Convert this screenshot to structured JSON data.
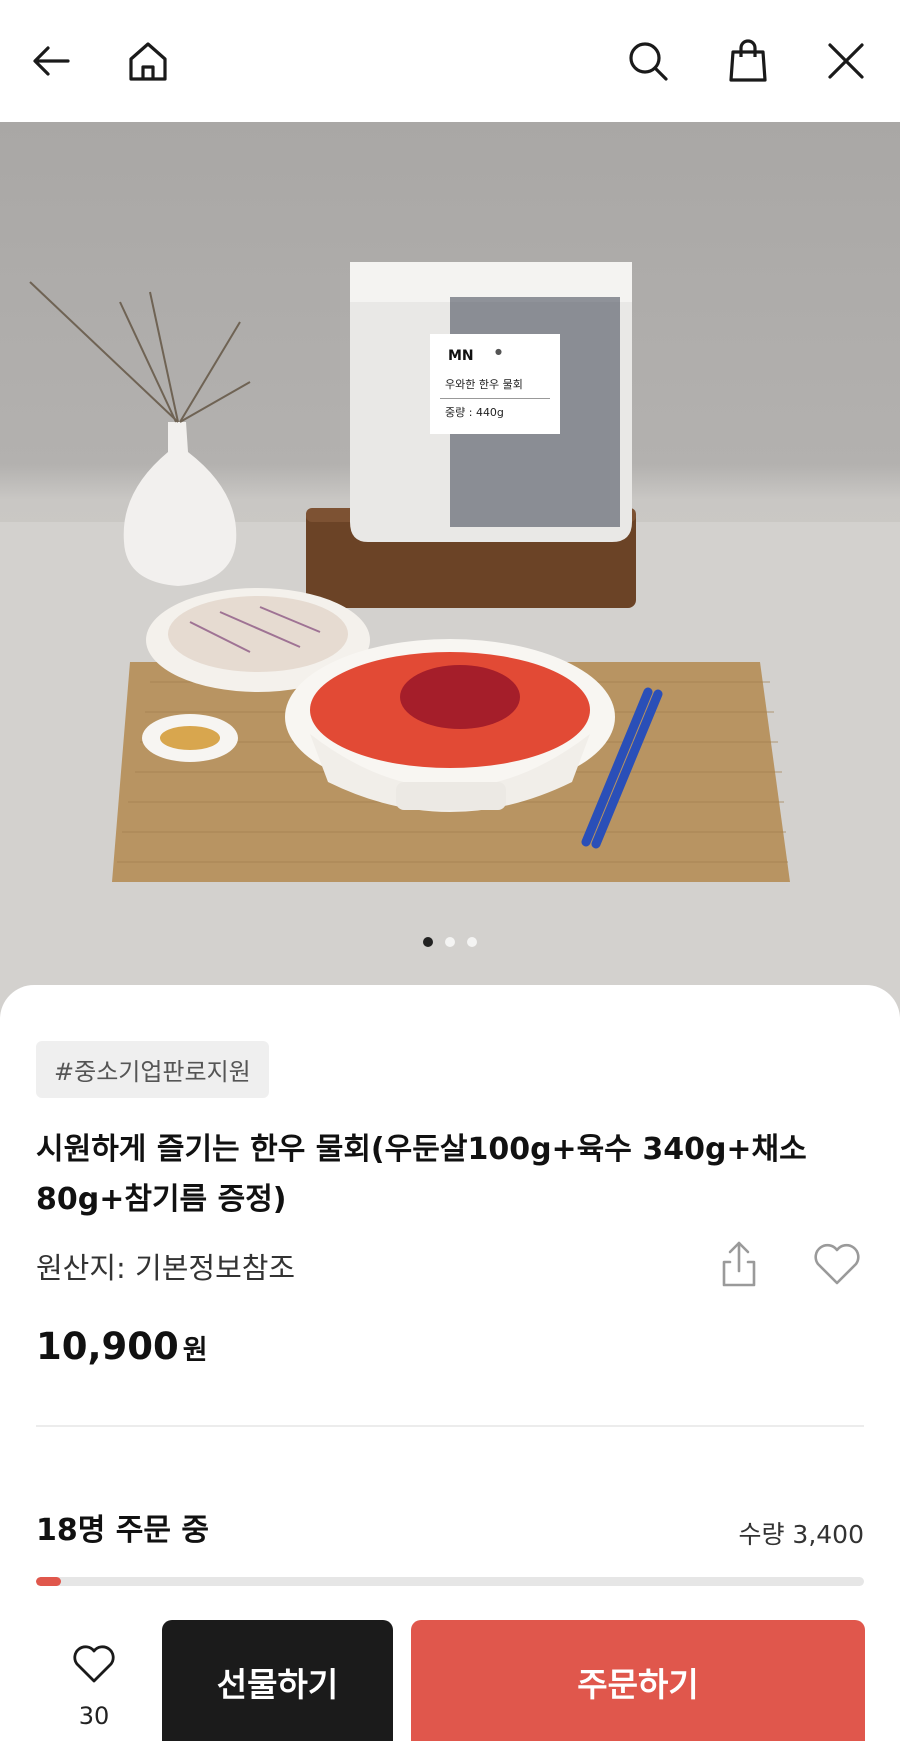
{
  "header": {
    "back_icon": "arrow-left-icon",
    "home_icon": "home-icon",
    "search_icon": "search-icon",
    "cart_icon": "shopping-bag-icon",
    "close_icon": "close-icon"
  },
  "hero": {
    "package_label": {
      "name": "우와한 한우 물회",
      "weight": "중량 : 440g"
    },
    "carousel": {
      "total": 3,
      "active_index": 1
    }
  },
  "product": {
    "tag": "#중소기업판로지원",
    "title": "시원하게 즐기는 한우 물회(우둔살100g+육수 340g+채소 80g+참기름 증정)",
    "origin": "원산지: 기본정보참조",
    "price": "10,900",
    "currency": "원"
  },
  "order_status": {
    "count_text": "18명 주문 중",
    "quantity_text": "수량 3,400",
    "progress_fraction": 0.03
  },
  "actions": {
    "wishlist_count": "30",
    "gift_label": "선물하기",
    "order_label": "주문하기"
  },
  "colors": {
    "accent": "#e0574c",
    "dark_button": "#1b1b1b",
    "tag_bg": "#efefef"
  }
}
